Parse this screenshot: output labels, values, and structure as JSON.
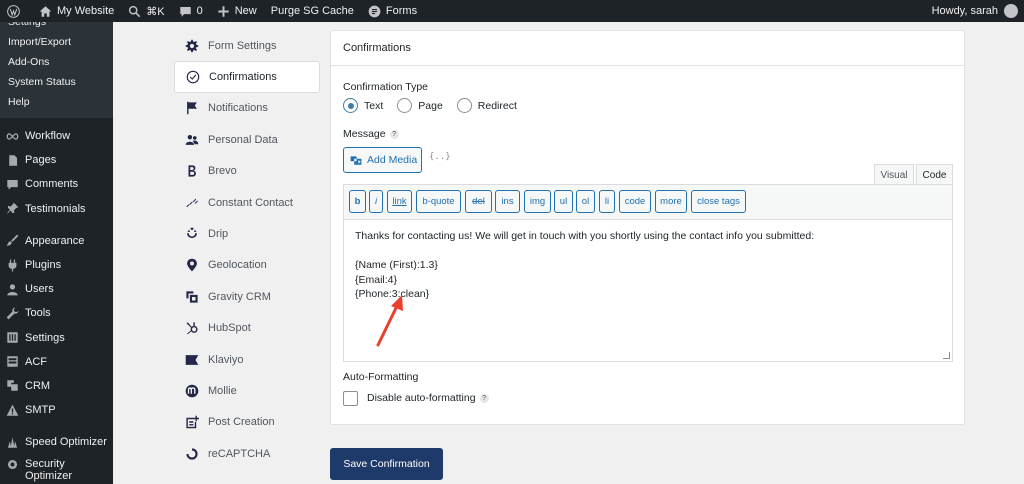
{
  "adminbar": {
    "site_name": "My Website",
    "shortcut": "⌘K",
    "comments_count": "0",
    "new_label": "New",
    "purge_label": "Purge SG Cache",
    "forms_label": "Forms",
    "howdy": "Howdy, sarah"
  },
  "adminmenu": {
    "submenu": [
      "Settings",
      "Import/Export",
      "Add-Ons",
      "System Status",
      "Help"
    ],
    "items": [
      "Workflow",
      "Pages",
      "Comments",
      "Testimonials",
      "Appearance",
      "Plugins",
      "Users",
      "Tools",
      "Settings",
      "ACF",
      "CRM",
      "SMTP",
      "Speed Optimizer",
      "Security Optimizer"
    ]
  },
  "settings_nav": [
    {
      "label": "Form Settings",
      "icon": "gear-icon"
    },
    {
      "label": "Confirmations",
      "icon": "check-circle-icon"
    },
    {
      "label": "Notifications",
      "icon": "flag-icon"
    },
    {
      "label": "Personal Data",
      "icon": "users-icon"
    },
    {
      "label": "Brevo",
      "icon": "brevo-icon"
    },
    {
      "label": "Constant Contact",
      "icon": "constant-contact-icon"
    },
    {
      "label": "Drip",
      "icon": "drip-icon"
    },
    {
      "label": "Geolocation",
      "icon": "map-pin-icon"
    },
    {
      "label": "Gravity CRM",
      "icon": "crm-icon"
    },
    {
      "label": "HubSpot",
      "icon": "hubspot-icon"
    },
    {
      "label": "Klaviyo",
      "icon": "klaviyo-icon"
    },
    {
      "label": "Mollie",
      "icon": "mollie-icon"
    },
    {
      "label": "Post Creation",
      "icon": "post-creation-icon"
    },
    {
      "label": "reCAPTCHA",
      "icon": "recaptcha-icon"
    }
  ],
  "panel": {
    "title": "Confirmations",
    "confirmation_type_label": "Confirmation Type",
    "radio_options": [
      "Text",
      "Page",
      "Redirect"
    ],
    "selected_type": "Text",
    "message_label": "Message",
    "help_mark": "?",
    "add_media_label": "Add Media",
    "merge_tag_icon": "{..}",
    "tab_visual": "Visual",
    "tab_code": "Code",
    "quicktags": [
      "b",
      "i",
      "link",
      "b-quote",
      "del",
      "ins",
      "img",
      "ul",
      "ol",
      "li",
      "code",
      "more",
      "close tags"
    ],
    "message_text": "Thanks for contacting us! We will get in touch with you shortly using the contact info you submitted:\n\n{Name (First):1.3}\n{Email:4}\n{Phone:3:clean}",
    "auto_formatting_label": "Auto-Formatting",
    "disable_auto_formatting_label": "Disable auto-formatting"
  },
  "save_button_label": "Save Confirmation",
  "colors": {
    "accent": "#2271b1",
    "save_button": "#1e3a6b",
    "annotation_arrow": "#e8412f",
    "admin_dark": "#1d2327"
  }
}
